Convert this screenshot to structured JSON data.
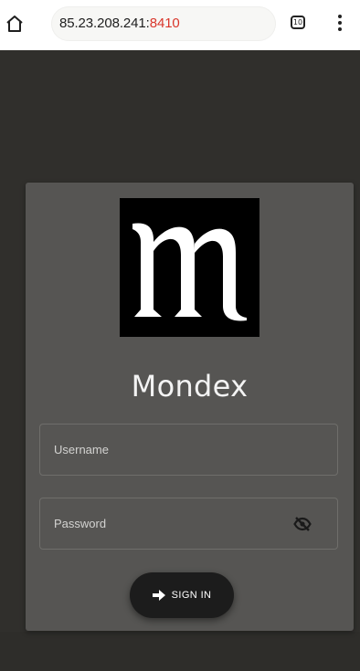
{
  "browser": {
    "url_host": "85.23.208.241:",
    "url_port": "8410",
    "tab_count": "10",
    "icons": {
      "home": "home-icon",
      "tabs": "tabs-icon",
      "menu": "more-vertical-icon"
    }
  },
  "login": {
    "brand_name": "Mondex",
    "logo_icon": "mondex-logo-icon",
    "username_placeholder": "Username",
    "password_placeholder": "Password",
    "password_toggle_icon": "eye-off-icon",
    "signin_label": "SIGN IN",
    "signin_icon": "arrow-right-icon"
  },
  "colors": {
    "page_background": "#302f2c",
    "card_background": "#565553",
    "logo_background": "#000000",
    "button_background": "#1c1c1c",
    "url_port_color": "#d9362b"
  }
}
